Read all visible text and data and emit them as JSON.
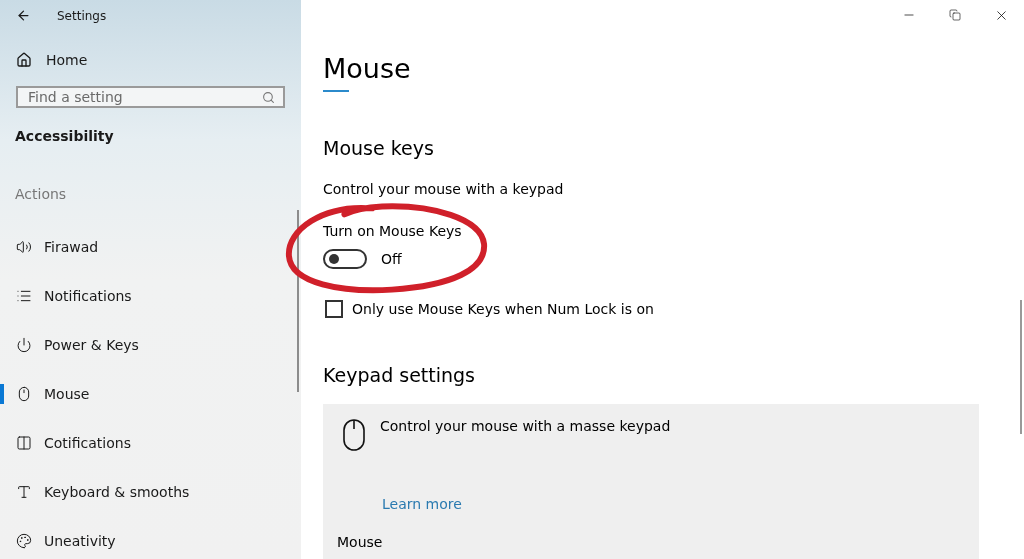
{
  "window": {
    "title": "Settings"
  },
  "sidebar": {
    "home": "Home",
    "search": {
      "placeholder": "Find a setting"
    },
    "section": "Accessibility",
    "group": "Actions",
    "items": [
      {
        "label": "Firawad",
        "selected": false
      },
      {
        "label": "Notifications",
        "selected": false
      },
      {
        "label": "Power & Keys",
        "selected": false
      },
      {
        "label": "Mouse",
        "selected": true
      },
      {
        "label": "Cotifications",
        "selected": false
      },
      {
        "label": "Keyboard & smooths",
        "selected": false
      },
      {
        "label": "Uneativity",
        "selected": false
      }
    ]
  },
  "page": {
    "title": "Mouse",
    "mouse_keys": {
      "heading": "Mouse keys",
      "description": "Control your mouse with a keypad",
      "toggle": {
        "label": "Turn on Mouse Keys",
        "on": false,
        "state_text": "Off"
      },
      "checkbox": {
        "label": "Only use Mouse Keys when Num Lock is on",
        "checked": false
      }
    },
    "keypad": {
      "heading": "Keypad settings",
      "card": {
        "text": "Control your mouse with a masse keypad",
        "link": "Learn more",
        "field_label": "Mouse"
      }
    }
  },
  "annotation": {
    "kind": "ring"
  }
}
